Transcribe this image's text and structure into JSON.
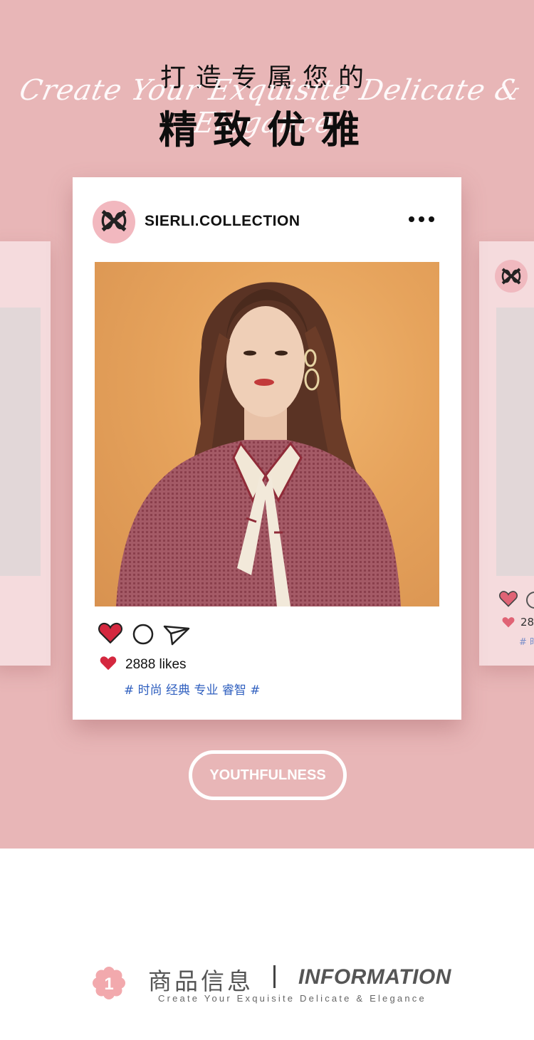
{
  "hero": {
    "heading_top": "打造专属您的",
    "script_line": "Create Your Exquisite Delicate & Elegance",
    "heading_main": "精致优雅"
  },
  "post": {
    "account": "SIERLI.COLLECTION",
    "likes": "2888 likes",
    "tags": "# 时尚 经典 专业 睿智 #",
    "peek_likes": "28",
    "peek_tags": "# 时"
  },
  "badge": {
    "label": "YOUTHFULNESS"
  },
  "info": {
    "number": "1",
    "title_cn": "商品信息",
    "title_en": "INFORMATION",
    "subtitle": "Create Your Exquisite Delicate & Elegance"
  },
  "colors": {
    "background_pink": "#e8b6b7",
    "heart_red": "#d4283f",
    "tag_blue": "#2f5fbf",
    "flower_pink": "#f2a9ad"
  },
  "icons": [
    "heart-icon",
    "comment-icon",
    "send-icon",
    "more-icon",
    "flower-icon",
    "brand-logo-icon"
  ]
}
